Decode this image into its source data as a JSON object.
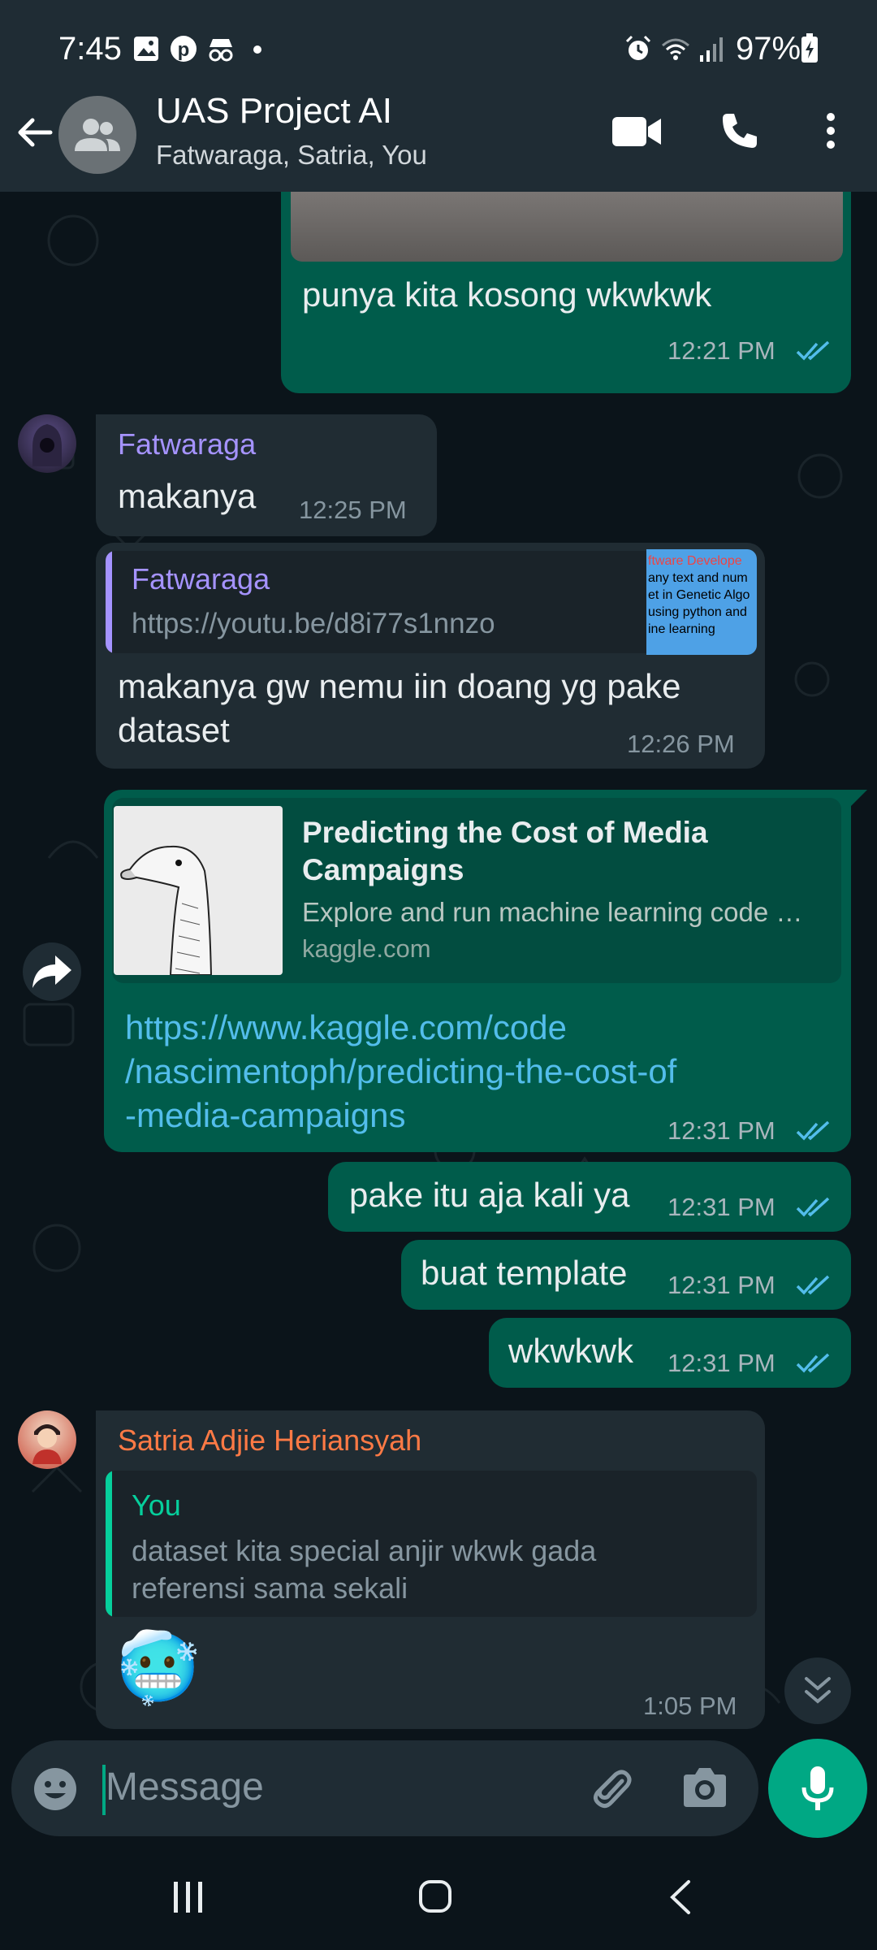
{
  "status_bar": {
    "time": "7:45",
    "battery": "97%",
    "icons": [
      "gallery-icon",
      "pinterest-icon",
      "incognito-icon",
      "dot-icon",
      "alarm-icon",
      "wifi-icon",
      "signal-icon",
      "battery-charging-icon"
    ]
  },
  "header": {
    "title": "UAS Project AI",
    "members": "Fatwaraga, Satria, You",
    "icons": [
      "back-arrow-icon",
      "group-avatar-icon",
      "video-call-icon",
      "voice-call-icon",
      "more-options-icon"
    ]
  },
  "messages": {
    "m1": {
      "text": "punya kita kosong wkwkwk",
      "time": "12:21 PM"
    },
    "m2": {
      "sender": "Fatwaraga",
      "text": "makanya",
      "time": "12:25 PM"
    },
    "m3": {
      "quote_sender": "Fatwaraga",
      "quote_text": "https://youtu.be/d8i77s1nnzo",
      "thumb_lines": [
        "ftware Develope",
        "any text and num",
        "et in Genetic Algo",
        "using python and",
        "ine learning"
      ],
      "text_line1": "makanya gw nemu iin doang yg pake",
      "text_line2": "dataset",
      "time": "12:26 PM"
    },
    "m4": {
      "preview_title_line1": "Predicting the Cost of Media",
      "preview_title_line2": "Campaigns",
      "preview_desc": "Explore and run machine learning code …",
      "preview_domain": "kaggle.com",
      "link_line1": "https://www.kaggle.com/code",
      "link_line2": "/nascimentoph/predicting-the-cost-of",
      "link_line3": "-media-campaigns",
      "time": "12:31 PM"
    },
    "m5": {
      "text": "pake itu aja kali ya",
      "time": "12:31 PM"
    },
    "m6": {
      "text": "buat template",
      "time": "12:31 PM"
    },
    "m7": {
      "text": "wkwkwk",
      "time": "12:31 PM"
    },
    "m8": {
      "sender": "Satria Adjie Heriansyah",
      "quote_sender": "You",
      "quote_line1": "dataset kita special anjir wkwk gada",
      "quote_line2": "referensi sama sekali",
      "emoji": "🥶",
      "time": "1:05 PM"
    }
  },
  "input": {
    "placeholder": "Message",
    "icons": [
      "emoji-icon",
      "attach-icon",
      "camera-icon",
      "mic-icon"
    ]
  },
  "colors": {
    "outgoing_bubble": "#005c4b",
    "incoming_bubble": "#202c33",
    "background": "#0b141a",
    "accent": "#00a884",
    "link": "#53bdeb",
    "sender_fatwaraga": "#a593ff",
    "sender_satria": "#ff7a45",
    "ticks": "#53bdeb"
  }
}
